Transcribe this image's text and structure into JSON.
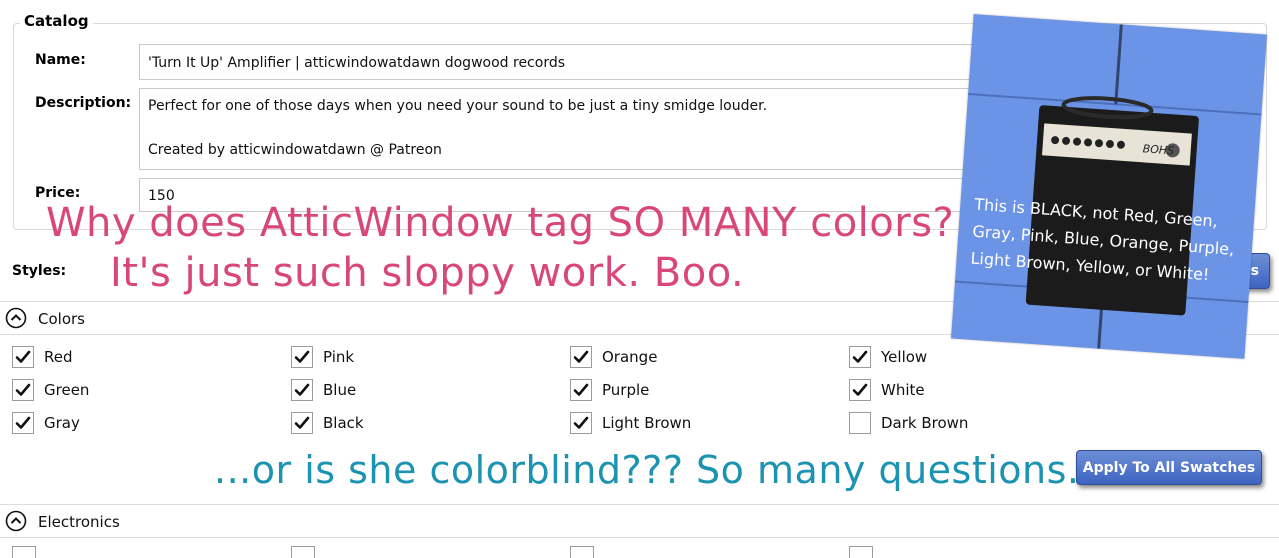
{
  "catalog": {
    "legend": "Catalog",
    "name_label": "Name:",
    "name_value": "'Turn It Up' Amplifier | atticwindowatdawn dogwood records",
    "description_label": "Description:",
    "description_line1": "Perfect for one of those days when you need your sound to be just a tiny smidge louder.",
    "description_line2": "Created by atticwindowatdawn @ Patreon",
    "price_label": "Price:",
    "price_value": "150"
  },
  "styles": {
    "label": "Styles:",
    "apply_button_partial": "hes"
  },
  "colors_section": {
    "title": "Colors",
    "items": [
      {
        "label": "Red",
        "checked": true
      },
      {
        "label": "Pink",
        "checked": true
      },
      {
        "label": "Orange",
        "checked": true
      },
      {
        "label": "Yellow",
        "checked": true
      },
      {
        "label": "Green",
        "checked": true
      },
      {
        "label": "Blue",
        "checked": true
      },
      {
        "label": "Purple",
        "checked": true
      },
      {
        "label": "White",
        "checked": true
      },
      {
        "label": "Gray",
        "checked": true
      },
      {
        "label": "Black",
        "checked": true
      },
      {
        "label": "Light Brown",
        "checked": true
      },
      {
        "label": "Dark Brown",
        "checked": false
      }
    ],
    "apply_button": "Apply To All Swatches"
  },
  "electronics_section": {
    "title": "Electronics"
  },
  "annotations": {
    "pink_line1": "Why does AtticWindow tag SO MANY colors?",
    "pink_line2": "It's just such sloppy work. Boo.",
    "blue_line": "...or is she colorblind??? So many questions.",
    "photo_caption": "This is BLACK, not Red, Green, Gray, Pink, Blue, Orange, Purple, Light Brown, Yellow, or White!",
    "amp_logo": "BOHS"
  },
  "colors": {
    "pink_text": "#d9467a",
    "blue_text": "#1c93b0",
    "button_blue": "#3e64c1",
    "photo_background": "#6b94e6"
  }
}
